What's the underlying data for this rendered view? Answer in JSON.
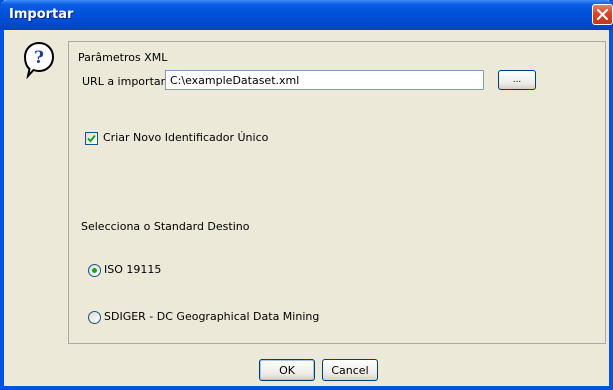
{
  "window": {
    "title": "Importar",
    "icons": {
      "close": "close-icon",
      "help": "question-icon"
    }
  },
  "panel": {
    "title": "Parâmetros XML",
    "url_label": "URL a importar",
    "url_value": "C:\\exampleDataset.xml",
    "browse_label": "...",
    "checkbox_label": "Criar Novo Identificador Único",
    "checkbox_checked": true,
    "standard_label": "Selecciona o Standard Destino",
    "radio_options": [
      {
        "label": "ISO 19115",
        "selected": true
      },
      {
        "label": "SDIGER - DC Geographical Data Mining",
        "selected": false
      }
    ]
  },
  "buttons": {
    "ok": "OK",
    "cancel": "Cancel"
  },
  "colors": {
    "titlebar": "#0050d8",
    "close": "#d5452a",
    "dialog_bg": "#ece9d8",
    "radio_dot": "#21a121",
    "check_mark": "#21a121"
  }
}
